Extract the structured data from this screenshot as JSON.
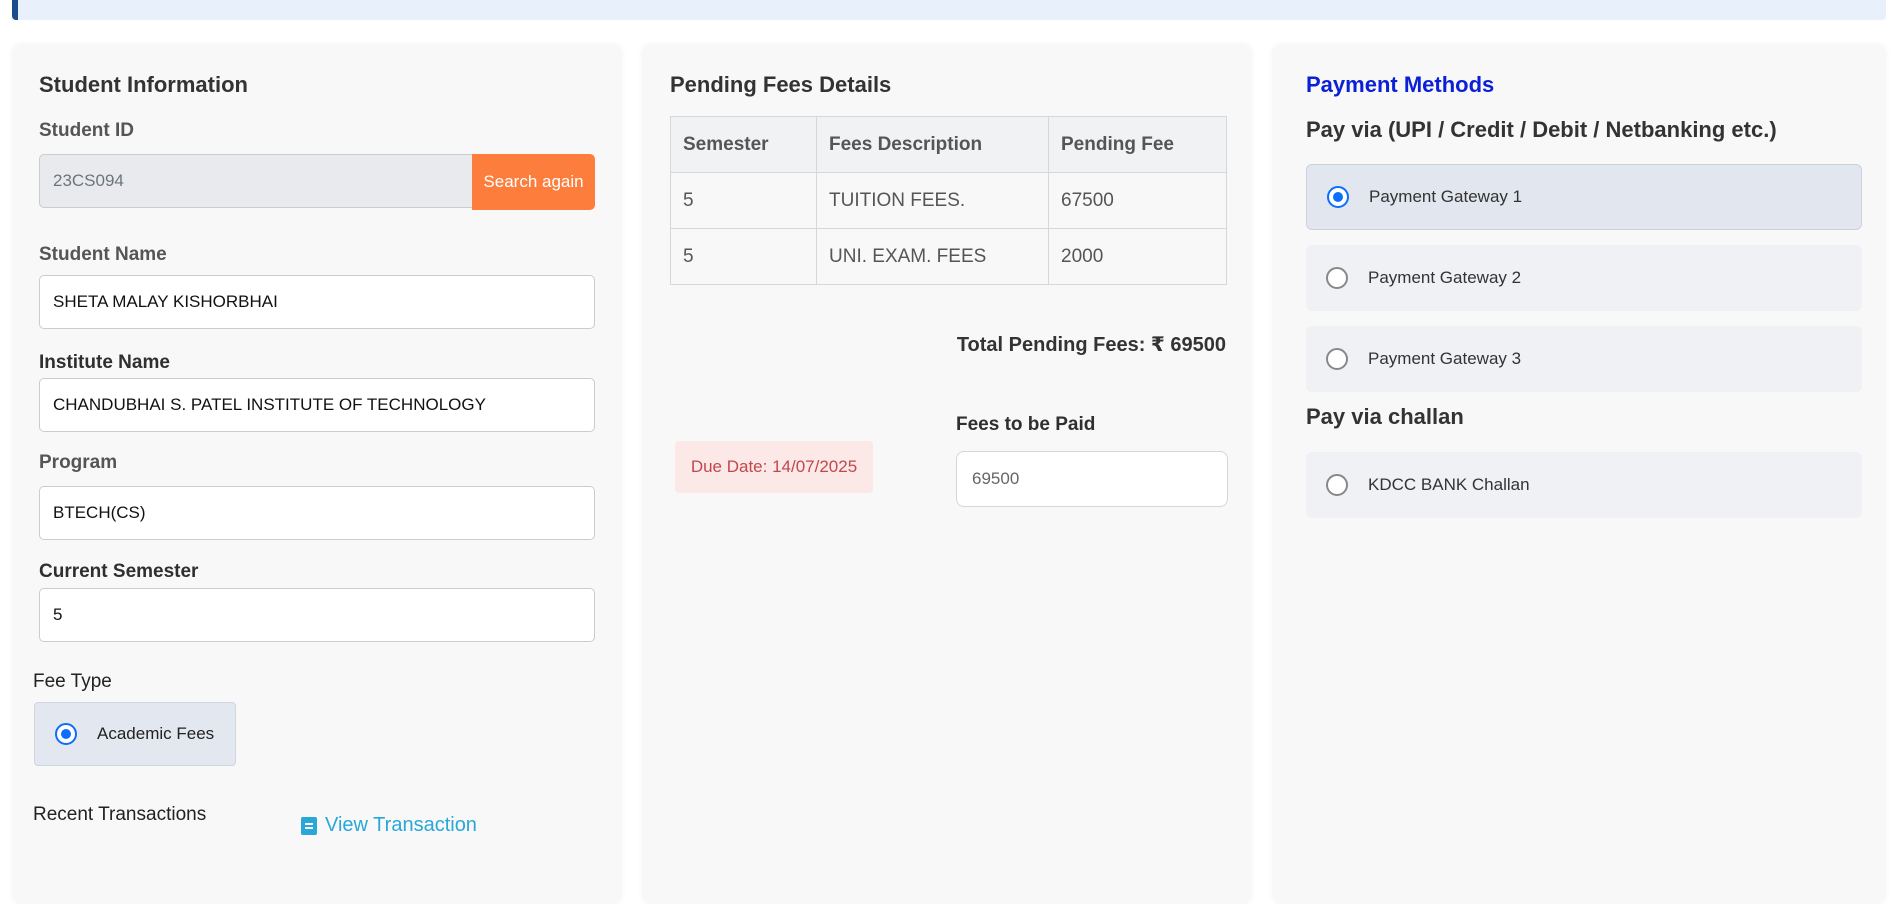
{
  "student_info": {
    "title": "Student Information",
    "student_id_label": "Student ID",
    "student_id_value": "23CS094",
    "search_again": "Search again",
    "student_name_label": "Student Name",
    "student_name_value": "SHETA MALAY KISHORBHAI",
    "institute_label": "Institute Name",
    "institute_value": "CHANDUBHAI S. PATEL INSTITUTE OF TECHNOLOGY",
    "program_label": "Program",
    "program_value": "BTECH(CS)",
    "semester_label": "Current Semester",
    "semester_value": "5",
    "fee_type_label": "Fee Type",
    "fee_type_option": "Academic Fees",
    "recent_tx_label": "Recent Transactions",
    "view_tx": "View Transaction"
  },
  "pending_fees": {
    "title": "Pending Fees Details",
    "columns": [
      "Semester",
      "Fees Description",
      "Pending Fee"
    ],
    "rows": [
      [
        "5",
        "TUITION FEES.",
        "67500"
      ],
      [
        "5",
        "UNI. EXAM. FEES",
        "2000"
      ]
    ],
    "total": "Total Pending Fees: ₹ 69500",
    "due_date": "Due Date: 14/07/2025",
    "fees_to_pay_label": "Fees to be Paid",
    "fees_to_pay_value": "69500"
  },
  "payment_methods": {
    "title": "Payment Methods",
    "online_heading": "Pay via (UPI / Credit / Debit / Netbanking etc.)",
    "gateways": [
      "Payment Gateway 1",
      "Payment Gateway 2",
      "Payment Gateway 3"
    ],
    "selected_gateway": "Payment Gateway 1",
    "challan_heading": "Pay via challan",
    "challan_option": "KDCC BANK Challan",
    "title_color": "#0a1fd6"
  },
  "colors": {
    "accent_orange": "#fd7e3c",
    "link_blue": "#29a7d8",
    "radio_blue": "#0d6efd"
  }
}
